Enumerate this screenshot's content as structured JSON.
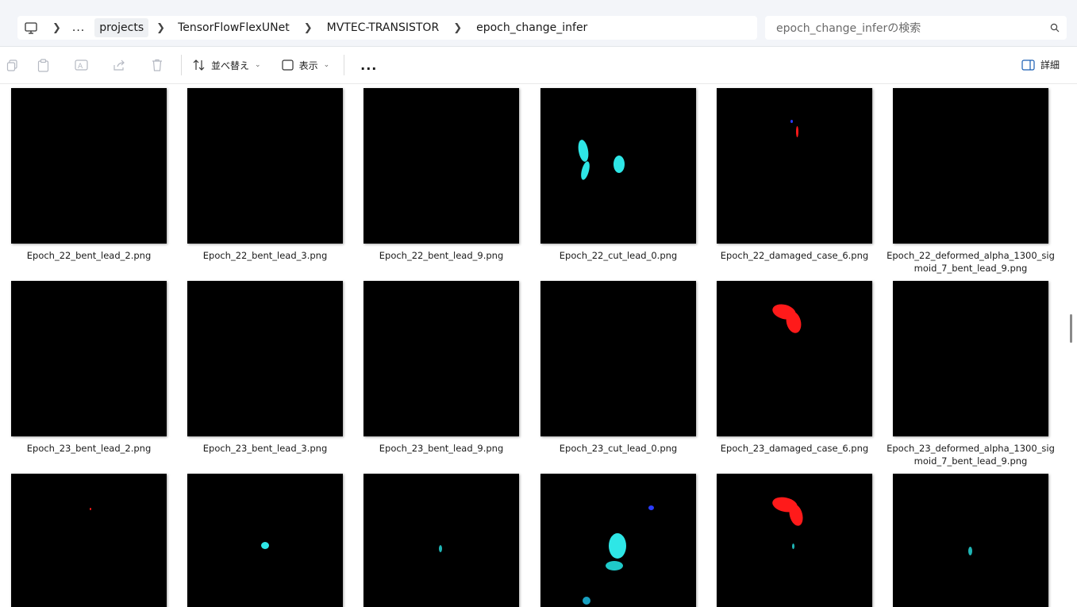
{
  "address_bar": {
    "overflow": "...",
    "crumbs": [
      "projects",
      "TensorFlowFlexUNet",
      "MVTEC-TRANSISTOR",
      "epoch_change_infer"
    ]
  },
  "search": {
    "placeholder": "epoch_change_inferの検索"
  },
  "toolbar": {
    "sort_label": "並べ替え",
    "view_label": "表示",
    "more_label": "...",
    "details_label": "詳細"
  },
  "files": {
    "row1": [
      "Epoch_22_bent_lead_2.png",
      "Epoch_22_bent_lead_3.png",
      "Epoch_22_bent_lead_9.png",
      "Epoch_22_cut_lead_0.png",
      "Epoch_22_damaged_case_6.png",
      "Epoch_22_deformed_alpha_1300_sigmoid_7_bent_lead_9.png"
    ],
    "row2": [
      "Epoch_23_bent_lead_2.png",
      "Epoch_23_bent_lead_3.png",
      "Epoch_23_bent_lead_9.png",
      "Epoch_23_cut_lead_0.png",
      "Epoch_23_damaged_case_6.png",
      "Epoch_23_deformed_alpha_1300_sigmoid_7_bent_lead_9.png"
    ]
  },
  "colors": {
    "cyan": "#2ee6e6",
    "red": "#ff1a1a",
    "blue": "#2a3cff"
  }
}
